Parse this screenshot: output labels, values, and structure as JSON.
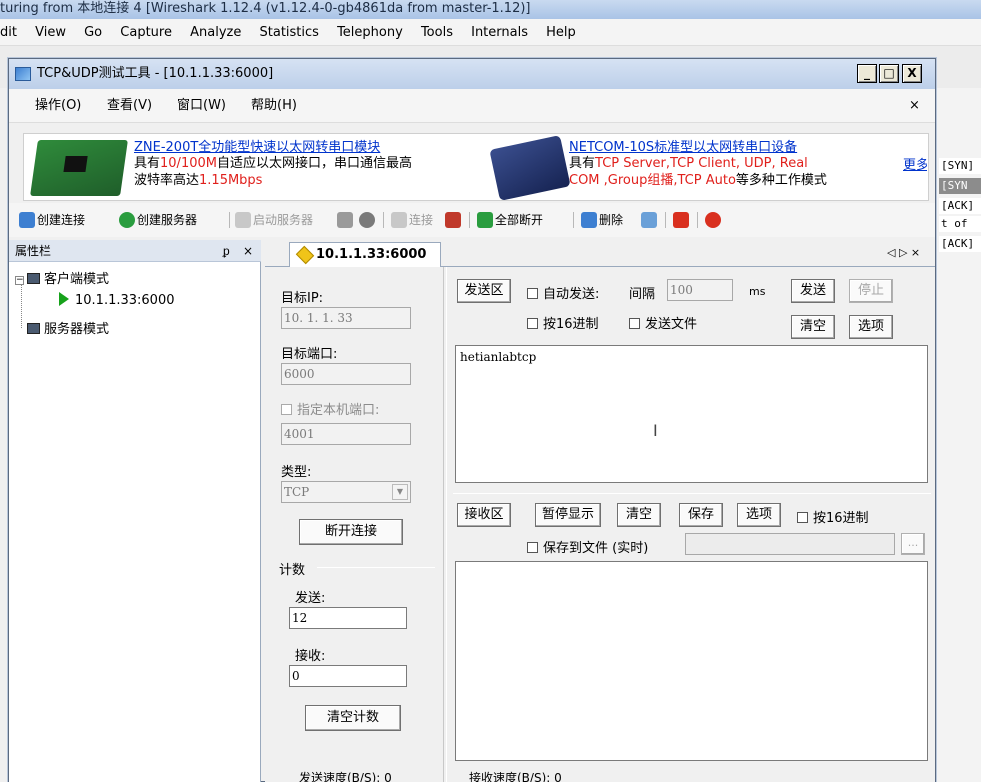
{
  "wireshark": {
    "title": "turing from 本地连接 4    [Wireshark 1.12.4  (v1.12.4-0-gb4861da from master-1.12)]",
    "menu": [
      "dit",
      "View",
      "Go",
      "Capture",
      "Analyze",
      "Statistics",
      "Telephony",
      "Tools",
      "Internals",
      "Help"
    ],
    "packets": [
      "[SYN]",
      "[SYN",
      "[ACK]",
      "t of",
      "[ACK]"
    ]
  },
  "window": {
    "title": "TCP&UDP测试工具 - [10.1.1.33:6000]",
    "min": "_",
    "max": "□",
    "close": "X"
  },
  "menubar": {
    "items": [
      "操作(O)",
      "查看(V)",
      "窗口(W)",
      "帮助(H)"
    ],
    "close": "×"
  },
  "banner": {
    "ad1": {
      "link": "ZNE-200T全功能型快速以太网转串口模块",
      "line2_a": "具有",
      "line2_red": "10/100M",
      "line2_b": "自适应以太网接口，串口通信最高",
      "line3_a": "波特率高达",
      "line3_red": "1.15Mbps"
    },
    "ad2": {
      "link": "NETCOM-10S标准型以太网转串口设备",
      "line2_a": "具有",
      "line2_red": "TCP Server,TCP Client, UDP, Real",
      "line3_red": "COM ,Group组播,TCP Auto",
      "line3_b": "等多种工作模式"
    },
    "more": "更多"
  },
  "toolbar": {
    "create_conn": "创建连接",
    "create_server": "创建服务器",
    "start_server": "启动服务器",
    "connect": "连接",
    "disconnect_all": "全部断开",
    "delete": "删除"
  },
  "left_panel": {
    "title": "属性栏",
    "pin": "ᵱ",
    "close": "×",
    "tree": {
      "client_mode": "客户端模式",
      "client_conn": "10.1.1.33:6000",
      "server_mode": "服务器模式"
    }
  },
  "tab": {
    "label": "10.1.1.33:6000",
    "nav": "◁ ▷ ×"
  },
  "conn": {
    "target_ip_label": "目标IP:",
    "target_ip": "10. 1. 1. 33",
    "target_port_label": "目标端口:",
    "target_port": "6000",
    "local_port_label": "指定本机端口:",
    "local_port": "4001",
    "type_label": "类型:",
    "type_value": "TCP",
    "disconnect_button": "断开连接"
  },
  "counts": {
    "title": "计数",
    "send_label": "发送:",
    "send_value": "12",
    "recv_label": "接收:",
    "recv_value": "0",
    "clear_button": "清空计数"
  },
  "send": {
    "area_button": "发送区",
    "auto_send": "自动发送:",
    "interval_label": "间隔",
    "interval_value": "100",
    "ms": "ms",
    "send_button": "发送",
    "stop_button": "停止",
    "hex": "按16进制",
    "send_file": "发送文件",
    "clear_button": "清空",
    "options_button": "选项",
    "text": "hetianlabtcp"
  },
  "recv": {
    "area_button": "接收区",
    "pause_button": "暂停显示",
    "clear_button": "清空",
    "save_button": "保存",
    "options_button": "选项",
    "hex": "按16进制",
    "save_file": "保存到文件 (实时)",
    "browse": "..."
  },
  "status": {
    "send_speed": "发送速度(B/S): 0",
    "recv_speed": "接收速度(B/S): 0"
  }
}
